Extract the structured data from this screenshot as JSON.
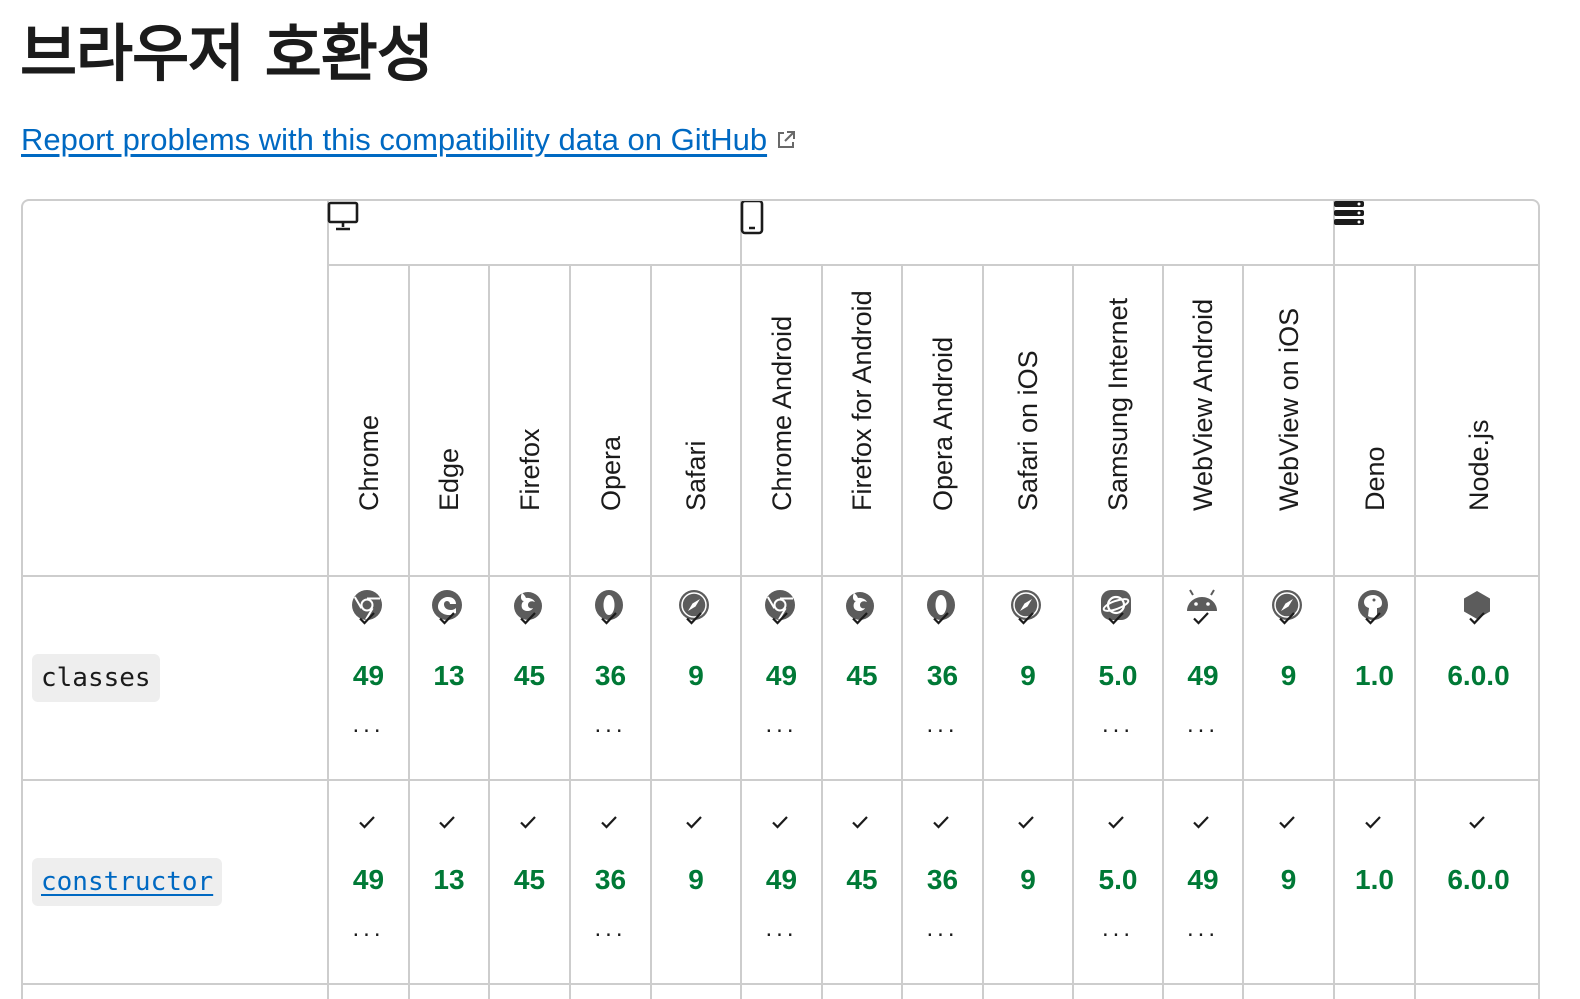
{
  "page": {
    "title": "브라우저 호환성"
  },
  "report_link": {
    "text": "Report problems with this compatibility data on GitHub",
    "icon": "external-link-icon"
  },
  "colors": {
    "link": "#0069c2",
    "supported": "#007936",
    "border": "#cdcdcd",
    "code_bg": "#eeeeee"
  },
  "platforms": [
    {
      "name": "desktop",
      "icon": "desktop-icon"
    },
    {
      "name": "mobile",
      "icon": "mobile-icon"
    },
    {
      "name": "server",
      "icon": "server-icon"
    }
  ],
  "browsers": [
    {
      "name": "Chrome",
      "icon": "chrome-icon"
    },
    {
      "name": "Edge",
      "icon": "edge-icon"
    },
    {
      "name": "Firefox",
      "icon": "firefox-icon"
    },
    {
      "name": "Opera",
      "icon": "opera-icon"
    },
    {
      "name": "Safari",
      "icon": "safari-icon"
    },
    {
      "name": "Chrome Android",
      "icon": "chrome-icon"
    },
    {
      "name": "Firefox for Android",
      "icon": "firefox-icon"
    },
    {
      "name": "Opera Android",
      "icon": "opera-icon"
    },
    {
      "name": "Safari on iOS",
      "icon": "safari-icon"
    },
    {
      "name": "Samsung Internet",
      "icon": "samsung-internet-icon"
    },
    {
      "name": "WebView Android",
      "icon": "android-icon"
    },
    {
      "name": "WebView on iOS",
      "icon": "safari-icon"
    },
    {
      "name": "Deno",
      "icon": "deno-icon"
    },
    {
      "name": "Node.js",
      "icon": "nodejs-icon"
    }
  ],
  "features": [
    {
      "name": "classes",
      "is_link": false,
      "support": [
        {
          "version": "49",
          "more": "..."
        },
        {
          "version": "13",
          "more": ""
        },
        {
          "version": "45",
          "more": ""
        },
        {
          "version": "36",
          "more": "..."
        },
        {
          "version": "9",
          "more": ""
        },
        {
          "version": "49",
          "more": "..."
        },
        {
          "version": "45",
          "more": ""
        },
        {
          "version": "36",
          "more": "..."
        },
        {
          "version": "9",
          "more": ""
        },
        {
          "version": "5.0",
          "more": "..."
        },
        {
          "version": "49",
          "more": "..."
        },
        {
          "version": "9",
          "more": ""
        },
        {
          "version": "1.0",
          "more": ""
        },
        {
          "version": "6.0.0",
          "more": ""
        }
      ]
    },
    {
      "name": "constructor",
      "is_link": true,
      "support": [
        {
          "version": "49",
          "more": "..."
        },
        {
          "version": "13",
          "more": ""
        },
        {
          "version": "45",
          "more": ""
        },
        {
          "version": "36",
          "more": "..."
        },
        {
          "version": "9",
          "more": ""
        },
        {
          "version": "49",
          "more": "..."
        },
        {
          "version": "45",
          "more": ""
        },
        {
          "version": "36",
          "more": "..."
        },
        {
          "version": "9",
          "more": ""
        },
        {
          "version": "5.0",
          "more": "..."
        },
        {
          "version": "49",
          "more": "..."
        },
        {
          "version": "9",
          "more": ""
        },
        {
          "version": "1.0",
          "more": ""
        },
        {
          "version": "6.0.0",
          "more": ""
        }
      ]
    }
  ]
}
